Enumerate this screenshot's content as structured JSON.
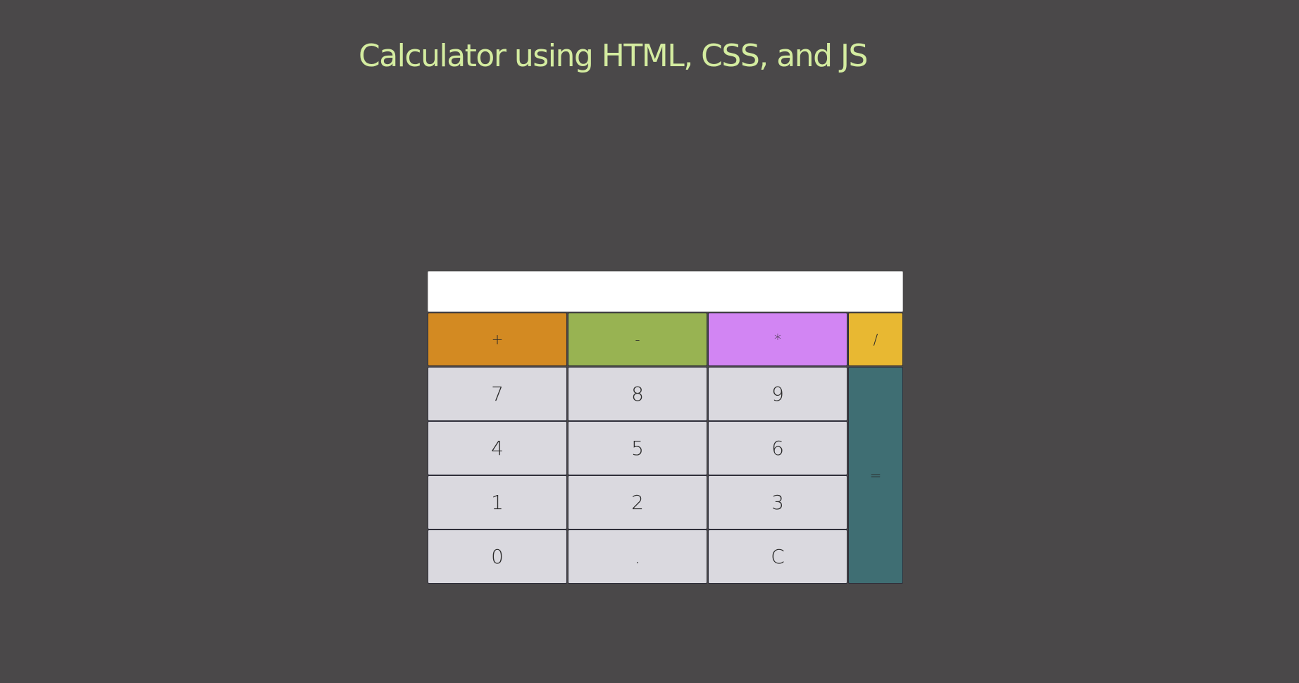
{
  "page": {
    "title": "Calculator using HTML, CSS, and JS"
  },
  "display": {
    "value": ""
  },
  "keys": {
    "add": "+",
    "subtract": "-",
    "multiply": "*",
    "divide": "/",
    "seven": "7",
    "eight": "8",
    "nine": "9",
    "four": "4",
    "five": "5",
    "six": "6",
    "one": "1",
    "two": "2",
    "three": "3",
    "zero": "0",
    "decimal": ".",
    "clear": "C",
    "equals": "="
  },
  "colors": {
    "background": "#4a4849",
    "title": "#d4eca0",
    "add": "#d38a22",
    "subtract": "#98b352",
    "multiply": "#d285f3",
    "divide": "#e8b832",
    "equals": "#3f6e73",
    "number_key": "#dad9df"
  }
}
